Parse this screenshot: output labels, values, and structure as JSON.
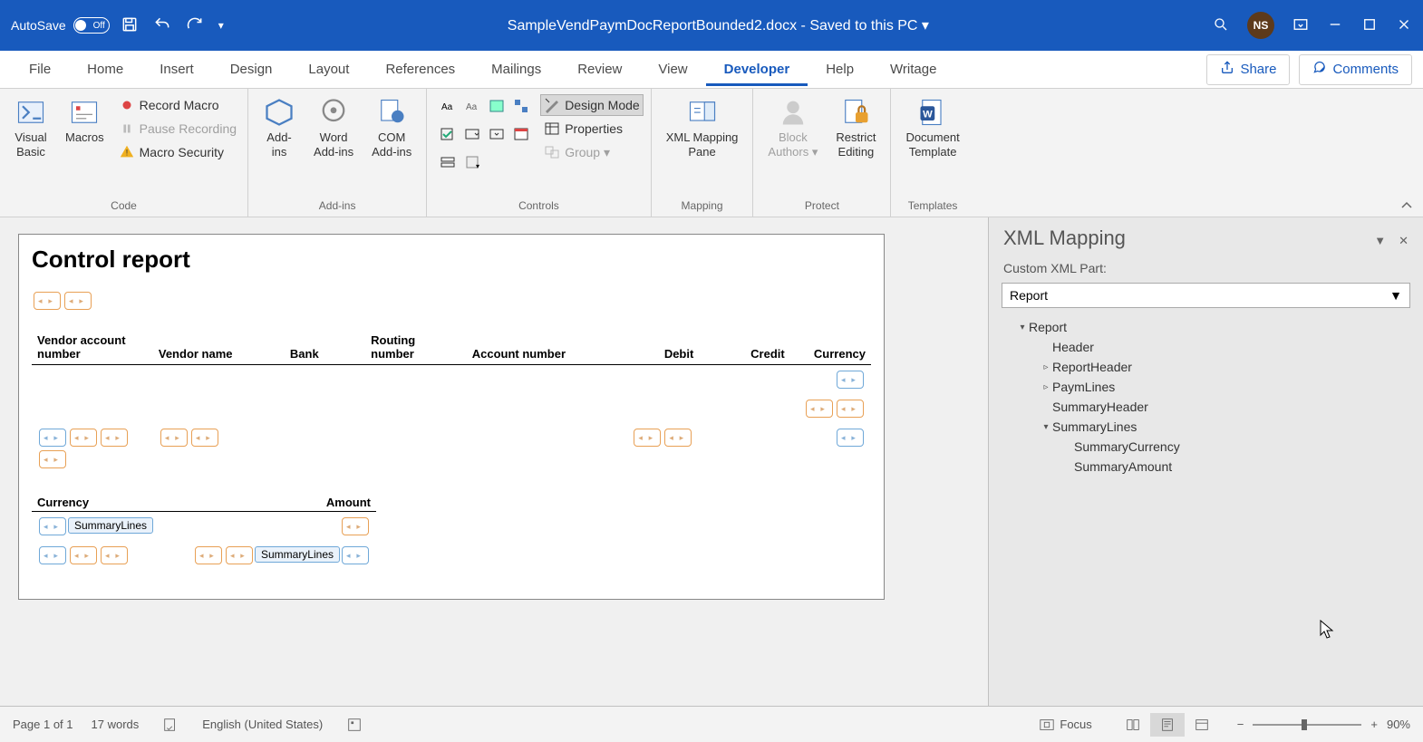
{
  "titlebar": {
    "autosave_label": "AutoSave",
    "autosave_state": "Off",
    "doc_title": "SampleVendPaymDocReportBounded2.docx - Saved to this PC ▾",
    "user_initials": "NS"
  },
  "ribbon_tabs": [
    "File",
    "Home",
    "Insert",
    "Design",
    "Layout",
    "References",
    "Mailings",
    "Review",
    "View",
    "Developer",
    "Help",
    "Writage"
  ],
  "active_tab": "Developer",
  "ribbon_actions": {
    "share": "Share",
    "comments": "Comments"
  },
  "ribbon": {
    "groups": {
      "code": {
        "label": "Code",
        "visual_basic": "Visual\nBasic",
        "macros": "Macros",
        "record": "Record Macro",
        "pause": "Pause Recording",
        "security": "Macro Security"
      },
      "addins": {
        "label": "Add-ins",
        "addins": "Add-\nins",
        "word_addins": "Word\nAdd-ins",
        "com_addins": "COM\nAdd-ins"
      },
      "controls": {
        "label": "Controls",
        "design_mode": "Design Mode",
        "properties": "Properties",
        "group": "Group ▾"
      },
      "mapping": {
        "label": "Mapping",
        "xml_pane": "XML Mapping\nPane"
      },
      "protect": {
        "label": "Protect",
        "block": "Block\nAuthors ▾",
        "restrict": "Restrict\nEditing"
      },
      "templates": {
        "label": "Templates",
        "template": "Document\nTemplate"
      }
    }
  },
  "document": {
    "title": "Control report",
    "table_headers": [
      "Vendor account number",
      "Vendor name",
      "Bank",
      "Routing number",
      "Account number",
      "Debit",
      "Credit",
      "Currency"
    ],
    "summary_headers": [
      "Currency",
      "Amount"
    ],
    "summary_tag": "SummaryLines"
  },
  "taskpane": {
    "title": "XML Mapping",
    "section_label": "Custom XML Part:",
    "selected_part": "Report",
    "tree": [
      {
        "level": 1,
        "caret": "▾",
        "label": "Report"
      },
      {
        "level": 2,
        "caret": "",
        "label": "Header"
      },
      {
        "level": 2,
        "caret": "▹",
        "label": "ReportHeader"
      },
      {
        "level": 2,
        "caret": "▹",
        "label": "PaymLines"
      },
      {
        "level": 2,
        "caret": "",
        "label": "SummaryHeader"
      },
      {
        "level": 2,
        "caret": "▾",
        "label": "SummaryLines"
      },
      {
        "level": 3,
        "caret": "",
        "label": "SummaryCurrency"
      },
      {
        "level": 3,
        "caret": "",
        "label": "SummaryAmount"
      }
    ]
  },
  "statusbar": {
    "page": "Page 1 of 1",
    "words": "17 words",
    "language": "English (United States)",
    "focus": "Focus",
    "zoom": "90%"
  }
}
